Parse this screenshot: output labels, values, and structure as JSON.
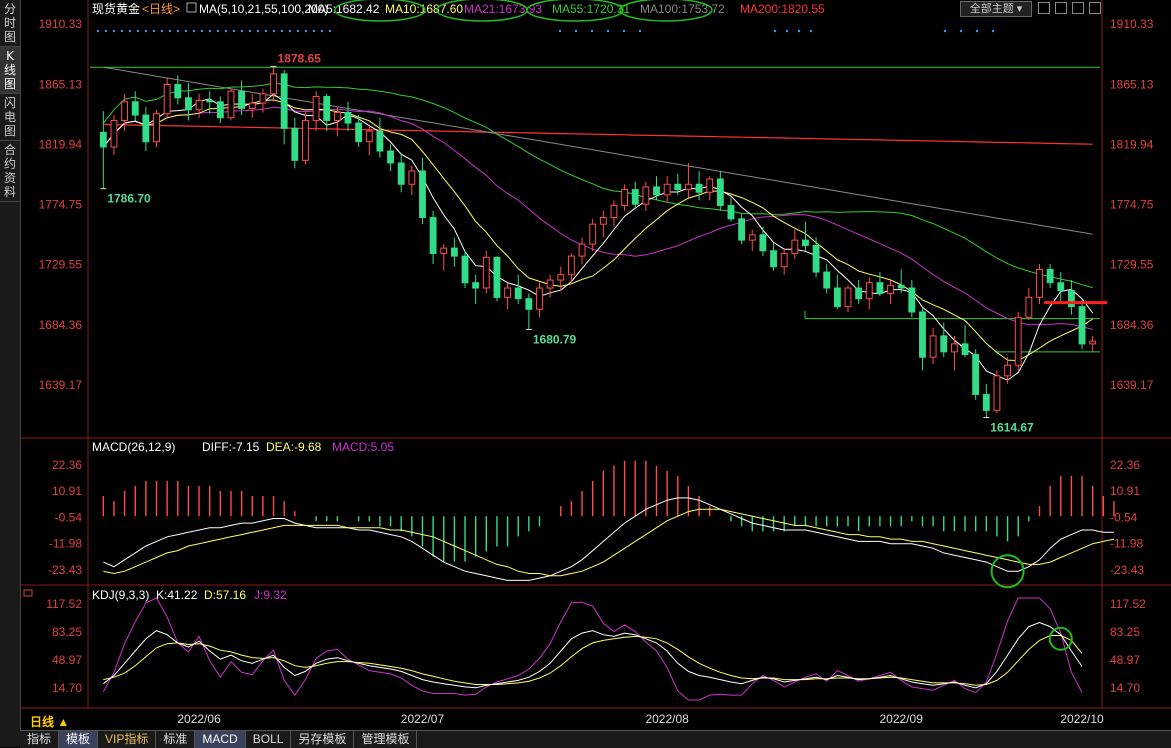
{
  "sidebar": {
    "tabs": [
      {
        "chars": [
          "分",
          "时",
          "图"
        ]
      },
      {
        "chars": [
          "K",
          "线",
          "图"
        ]
      },
      {
        "chars": [
          "闪",
          "电",
          "图"
        ]
      },
      {
        "chars": [
          "合",
          "约",
          "资",
          "料"
        ]
      }
    ]
  },
  "header": {
    "symbol": "现货黄金",
    "period_tag": "<日线>",
    "ma_label": "MA(5,10,21,55,100,200)",
    "ma_values": [
      {
        "label": "MA5:1682.42",
        "color": "#ffffff"
      },
      {
        "label": "MA10:1687.60",
        "color": "#ffff66"
      },
      {
        "label": "MA21:1673.93",
        "color": "#cc33cc"
      },
      {
        "label": "MA55:1720.31",
        "color": "#33cc33"
      },
      {
        "label": "MA100:1753.72",
        "color": "#888888"
      },
      {
        "label": "MA200:1820.55",
        "color": "#ff3333"
      }
    ],
    "theme_button": "全部主题"
  },
  "price_axis": {
    "ticks": [
      "1910.33",
      "1865.13",
      "1819.94",
      "1774.75",
      "1729.55",
      "1684.36",
      "1639.17"
    ],
    "annotations": [
      "1878.65",
      "1786.70",
      "1680.79",
      "1614.67"
    ]
  },
  "macd_panel": {
    "label": "MACD(26,12,9)",
    "diff": "DIFF:-7.15",
    "dea": "DEA:-9.68",
    "macd": "MACD:5.05",
    "ticks": [
      "22.36",
      "10.91",
      "-0.54",
      "-11.98",
      "-23.43"
    ]
  },
  "kdj_panel": {
    "label": "KDJ(9,3,3)",
    "k": "K:41.22",
    "d": "D:57.16",
    "j": "J:9.32",
    "ticks": [
      "117.52",
      "83.25",
      "48.97",
      "14.70"
    ]
  },
  "x_axis": {
    "labels": [
      "2022/06",
      "2022/07",
      "2022/08",
      "2022/09",
      "2022/10"
    ]
  },
  "period_selector": "日线 ▲",
  "bottom_tabs": [
    {
      "label": "指标"
    },
    {
      "label": "模板"
    },
    {
      "label": "VIP指标"
    },
    {
      "label": "标准"
    },
    {
      "label": "MACD"
    },
    {
      "label": "BOLL"
    },
    {
      "label": "另存模板"
    },
    {
      "label": "管理模板"
    }
  ],
  "chart_data": [
    {
      "type": "candlestick",
      "series_name": "现货黄金 日线",
      "ylim": [
        1600,
        1915
      ],
      "ohlc": [
        [
          1829,
          1845,
          1786.7,
          1818
        ],
        [
          1818,
          1842,
          1812,
          1838
        ],
        [
          1838,
          1858,
          1830,
          1852
        ],
        [
          1852,
          1860,
          1838,
          1842
        ],
        [
          1842,
          1848,
          1815,
          1822
        ],
        [
          1822,
          1846,
          1818,
          1843
        ],
        [
          1843,
          1870,
          1840,
          1865
        ],
        [
          1865,
          1872,
          1850,
          1855
        ],
        [
          1855,
          1866,
          1838,
          1846
        ],
        [
          1846,
          1858,
          1840,
          1853
        ],
        [
          1853,
          1860,
          1843,
          1852
        ],
        [
          1852,
          1856,
          1836,
          1840
        ],
        [
          1840,
          1862,
          1838,
          1860
        ],
        [
          1860,
          1868,
          1842,
          1847
        ],
        [
          1847,
          1858,
          1840,
          1851
        ],
        [
          1851,
          1862,
          1844,
          1858
        ],
        [
          1858,
          1878.65,
          1852,
          1873
        ],
        [
          1873,
          1876,
          1820,
          1832
        ],
        [
          1832,
          1840,
          1802,
          1808
        ],
        [
          1808,
          1844,
          1805,
          1838
        ],
        [
          1838,
          1860,
          1830,
          1856
        ],
        [
          1856,
          1858,
          1830,
          1838
        ],
        [
          1838,
          1848,
          1826,
          1844
        ],
        [
          1844,
          1852,
          1830,
          1836
        ],
        [
          1836,
          1842,
          1818,
          1822
        ],
        [
          1822,
          1834,
          1812,
          1830
        ],
        [
          1830,
          1840,
          1810,
          1815
        ],
        [
          1815,
          1820,
          1800,
          1806
        ],
        [
          1806,
          1812,
          1784,
          1790
        ],
        [
          1790,
          1804,
          1782,
          1800
        ],
        [
          1800,
          1810,
          1760,
          1765
        ],
        [
          1765,
          1770,
          1730,
          1738
        ],
        [
          1738,
          1745,
          1725,
          1742
        ],
        [
          1742,
          1750,
          1728,
          1736
        ],
        [
          1736,
          1740,
          1712,
          1716
        ],
        [
          1716,
          1722,
          1700,
          1712
        ],
        [
          1712,
          1740,
          1708,
          1735
        ],
        [
          1735,
          1736,
          1702,
          1705
        ],
        [
          1705,
          1716,
          1696,
          1712
        ],
        [
          1712,
          1722,
          1700,
          1704
        ],
        [
          1704,
          1708,
          1680.79,
          1696
        ],
        [
          1696,
          1716,
          1690,
          1712
        ],
        [
          1712,
          1722,
          1705,
          1718
        ],
        [
          1718,
          1728,
          1710,
          1722
        ],
        [
          1722,
          1738,
          1716,
          1736
        ],
        [
          1736,
          1750,
          1730,
          1745
        ],
        [
          1745,
          1764,
          1740,
          1760
        ],
        [
          1760,
          1770,
          1750,
          1765
        ],
        [
          1765,
          1778,
          1758,
          1774
        ],
        [
          1774,
          1790,
          1770,
          1786
        ],
        [
          1786,
          1792,
          1772,
          1775
        ],
        [
          1775,
          1792,
          1770,
          1788
        ],
        [
          1788,
          1796,
          1778,
          1782
        ],
        [
          1782,
          1796,
          1776,
          1790
        ],
        [
          1790,
          1798,
          1782,
          1786
        ],
        [
          1786,
          1806,
          1780,
          1790
        ],
        [
          1790,
          1800,
          1778,
          1784
        ],
        [
          1784,
          1796,
          1778,
          1794
        ],
        [
          1794,
          1800,
          1770,
          1774
        ],
        [
          1774,
          1780,
          1762,
          1764
        ],
        [
          1764,
          1768,
          1745,
          1748
        ],
        [
          1748,
          1756,
          1740,
          1752
        ],
        [
          1752,
          1758,
          1736,
          1740
        ],
        [
          1740,
          1746,
          1725,
          1728
        ],
        [
          1728,
          1742,
          1722,
          1738
        ],
        [
          1738,
          1756,
          1734,
          1748
        ],
        [
          1748,
          1762,
          1740,
          1744
        ],
        [
          1744,
          1750,
          1720,
          1724
        ],
        [
          1724,
          1730,
          1708,
          1712
        ],
        [
          1712,
          1722,
          1696,
          1698
        ],
        [
          1698,
          1714,
          1694,
          1712
        ],
        [
          1712,
          1718,
          1700,
          1704
        ],
        [
          1704,
          1720,
          1696,
          1716
        ],
        [
          1716,
          1724,
          1706,
          1708
        ],
        [
          1708,
          1718,
          1700,
          1714
        ],
        [
          1714,
          1726,
          1708,
          1712
        ],
        [
          1712,
          1718,
          1690,
          1694
        ],
        [
          1694,
          1698,
          1650,
          1660
        ],
        [
          1660,
          1682,
          1655,
          1676
        ],
        [
          1676,
          1686,
          1660,
          1664
        ],
        [
          1664,
          1676,
          1650,
          1670
        ],
        [
          1670,
          1684,
          1660,
          1662
        ],
        [
          1662,
          1666,
          1628,
          1632
        ],
        [
          1632,
          1640,
          1614.67,
          1620
        ],
        [
          1620,
          1650,
          1618,
          1646
        ],
        [
          1646,
          1660,
          1640,
          1654
        ],
        [
          1654,
          1694,
          1650,
          1690
        ],
        [
          1690,
          1712,
          1688,
          1705
        ],
        [
          1705,
          1730,
          1700,
          1726
        ],
        [
          1726,
          1730,
          1712,
          1716
        ],
        [
          1716,
          1724,
          1700,
          1710
        ],
        [
          1710,
          1718,
          1692,
          1698
        ],
        [
          1698,
          1704,
          1666,
          1670
        ],
        [
          1670,
          1676,
          1664,
          1672
        ]
      ],
      "levels": {
        "upper_line": 1878,
        "mid_line": 1689,
        "low_line": 1664,
        "red_line": 1701
      },
      "ma_lines": [
        "MA5",
        "MA10",
        "MA21",
        "MA55",
        "MA100",
        "MA200"
      ]
    },
    {
      "type": "bar",
      "series_name": "MACD",
      "ylim": [
        -30,
        28
      ],
      "diff": [
        -20,
        -22,
        -19,
        -16,
        -13,
        -11,
        -9,
        -8,
        -7,
        -6,
        -5,
        -5,
        -4,
        -3,
        -3,
        -2,
        -1,
        -1,
        -3,
        -4,
        -5,
        -5,
        -5,
        -5,
        -6,
        -6,
        -7,
        -8,
        -9,
        -11,
        -14,
        -17,
        -20,
        -22,
        -24,
        -25,
        -26,
        -27,
        -28,
        -28,
        -28,
        -27,
        -26,
        -24,
        -22,
        -19,
        -15,
        -11,
        -7,
        -3,
        0,
        3,
        5,
        7,
        8,
        8,
        7,
        5,
        3,
        1,
        -1,
        -3,
        -4,
        -5,
        -6,
        -6,
        -6,
        -7,
        -8,
        -9,
        -10,
        -11,
        -11,
        -11,
        -12,
        -12,
        -12,
        -13,
        -14,
        -16,
        -17,
        -18,
        -19,
        -20,
        -22,
        -24,
        -24,
        -22,
        -19,
        -14,
        -10,
        -8,
        -6,
        -6,
        -7,
        -7
      ],
      "dea": [
        -24,
        -25,
        -24,
        -22,
        -20,
        -18,
        -16,
        -15,
        -13,
        -12,
        -11,
        -10,
        -9,
        -8,
        -7,
        -6,
        -5,
        -4,
        -4,
        -4,
        -4,
        -4,
        -4,
        -5,
        -5,
        -5,
        -5,
        -6,
        -6,
        -7,
        -8,
        -9,
        -11,
        -13,
        -15,
        -17,
        -19,
        -21,
        -22,
        -24,
        -25,
        -25,
        -26,
        -26,
        -25,
        -24,
        -22,
        -20,
        -17,
        -14,
        -11,
        -8,
        -5,
        -2,
        0,
        2,
        3,
        3,
        3,
        2,
        1,
        0,
        -1,
        -2,
        -3,
        -4,
        -4,
        -5,
        -6,
        -7,
        -8,
        -8,
        -9,
        -9,
        -10,
        -10,
        -11,
        -11,
        -12,
        -13,
        -14,
        -15,
        -16,
        -17,
        -18,
        -19,
        -20,
        -21,
        -21,
        -20,
        -18,
        -16,
        -14,
        -12,
        -11,
        -10
      ],
      "hist": [
        4,
        3,
        5,
        6,
        7,
        7,
        7,
        7,
        6,
        6,
        6,
        5,
        5,
        5,
        4,
        4,
        4,
        3,
        1,
        0,
        -1,
        -1,
        -1,
        0,
        -1,
        -1,
        -2,
        -2,
        -3,
        -4,
        -6,
        -8,
        -9,
        -9,
        -9,
        -8,
        -7,
        -6,
        -6,
        -4,
        -3,
        -2,
        0,
        2,
        3,
        5,
        7,
        9,
        10,
        11,
        11,
        11,
        10,
        9,
        8,
        6,
        4,
        2,
        0,
        -1,
        -2,
        -3,
        -3,
        -3,
        -3,
        -2,
        -2,
        -2,
        -2,
        -2,
        -2,
        -3,
        -2,
        -2,
        -2,
        -2,
        -1,
        -2,
        -2,
        -3,
        -3,
        -3,
        -3,
        -3,
        -4,
        -5,
        -4,
        -1,
        2,
        6,
        8,
        8,
        8,
        6,
        4,
        3
      ]
    },
    {
      "type": "line",
      "series_name": "KDJ",
      "ylim": [
        0,
        125
      ],
      "k": [
        20,
        30,
        45,
        60,
        75,
        85,
        80,
        70,
        65,
        72,
        60,
        50,
        55,
        48,
        45,
        50,
        55,
        40,
        30,
        35,
        45,
        50,
        52,
        48,
        45,
        42,
        40,
        38,
        35,
        30,
        25,
        22,
        20,
        18,
        16,
        15,
        18,
        20,
        22,
        24,
        28,
        35,
        45,
        60,
        75,
        82,
        85,
        80,
        78,
        82,
        80,
        75,
        70,
        60,
        45,
        35,
        30,
        28,
        25,
        22,
        20,
        24,
        28,
        26,
        22,
        24,
        26,
        28,
        25,
        30,
        28,
        25,
        26,
        28,
        30,
        26,
        22,
        20,
        18,
        20,
        22,
        18,
        15,
        20,
        35,
        55,
        75,
        90,
        95,
        90,
        80,
        60,
        41.22
      ],
      "d": [
        25,
        28,
        33,
        42,
        53,
        64,
        69,
        70,
        68,
        69,
        66,
        61,
        59,
        55,
        52,
        51,
        52,
        48,
        42,
        40,
        42,
        45,
        47,
        47,
        46,
        45,
        43,
        41,
        39,
        36,
        32,
        29,
        26,
        23,
        21,
        19,
        19,
        19,
        20,
        21,
        23,
        27,
        33,
        42,
        53,
        63,
        70,
        73,
        75,
        77,
        78,
        77,
        75,
        70,
        62,
        53,
        45,
        39,
        34,
        30,
        27,
        26,
        27,
        27,
        25,
        25,
        25,
        26,
        26,
        27,
        27,
        26,
        26,
        27,
        28,
        27,
        25,
        23,
        21,
        21,
        21,
        20,
        18,
        19,
        24,
        34,
        48,
        62,
        73,
        79,
        79,
        73,
        57.16
      ],
      "j": [
        10,
        34,
        69,
        96,
        119,
        127,
        102,
        70,
        59,
        78,
        48,
        28,
        47,
        34,
        31,
        48,
        61,
        24,
        6,
        25,
        51,
        60,
        62,
        50,
        43,
        36,
        34,
        32,
        27,
        18,
        11,
        8,
        8,
        8,
        6,
        7,
        16,
        22,
        26,
        30,
        38,
        51,
        69,
        96,
        119,
        120,
        115,
        94,
        84,
        92,
        84,
        71,
        60,
        40,
        11,
        -1,
        0,
        6,
        7,
        6,
        6,
        20,
        30,
        24,
        16,
        22,
        28,
        32,
        23,
        36,
        30,
        23,
        26,
        30,
        34,
        24,
        16,
        14,
        12,
        18,
        24,
        14,
        9,
        22,
        57,
        97,
        129,
        146,
        139,
        112,
        82,
        34,
        9.32
      ]
    }
  ]
}
